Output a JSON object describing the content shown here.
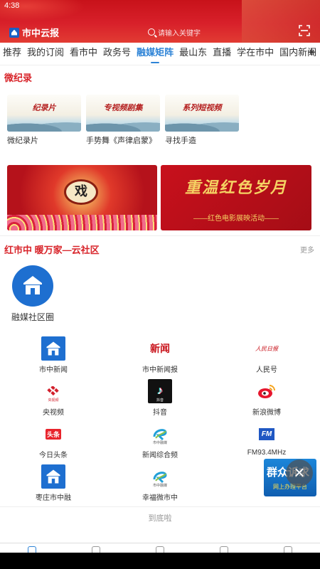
{
  "status": {
    "time": "4:38"
  },
  "header": {
    "brand": "市中云报",
    "search_placeholder": "请输入关键字"
  },
  "tabs": [
    "推荐",
    "我的订阅",
    "看市中",
    "政务号",
    "融媒矩阵",
    "最山东",
    "直播",
    "学在市中",
    "国内新闻"
  ],
  "active_tab": "融媒矩阵",
  "documentary": {
    "title": "微纪录",
    "items": [
      {
        "label": "微纪录片",
        "art": "纪录片"
      },
      {
        "label": "手势舞《声律启蒙》",
        "art": "专视频剧集"
      },
      {
        "label": "寻找手造",
        "art": "系列短视频"
      }
    ]
  },
  "banners": {
    "left_art": "戏",
    "right_art": "重温红色岁月",
    "right_sub": "——红色电影展映活动——"
  },
  "community": {
    "title": "红市中  暖万家—云社区",
    "more": "更多",
    "label": "融媒社区圈"
  },
  "grid": [
    {
      "label": "市中新闻",
      "icon": "shizhong-icon"
    },
    {
      "label": "市中新闻报",
      "icon": "xinwen-icon",
      "art": "新闻"
    },
    {
      "label": "人民号",
      "icon": "renmin-icon",
      "art": "人民日报"
    },
    {
      "label": "央视频",
      "icon": "cctv-icon",
      "art": "央视频"
    },
    {
      "label": "抖音",
      "icon": "douyin-icon",
      "art": "抖音"
    },
    {
      "label": "新浪微博",
      "icon": "weibo-icon"
    },
    {
      "label": "今日头条",
      "icon": "toutiao-icon",
      "art": "头条"
    },
    {
      "label": "新闻综合频",
      "icon": "news-channel-icon",
      "art": "市中融媒"
    },
    {
      "label": "FM93.4MHz",
      "icon": "fm-icon",
      "art": "FM"
    },
    {
      "label": "枣庄市中融",
      "icon": "zaozhuang-icon"
    },
    {
      "label": "幸福微市中",
      "icon": "xingfu-icon",
      "art": "市中融媒"
    }
  ],
  "float_ad": {
    "line1": "群众诉求",
    "line2": "网上办理平台"
  },
  "footer": {
    "end_text": "到底啦"
  },
  "colors": {
    "brand_red": "#d8202a",
    "accent_blue": "#2d83d6",
    "section_red": "#d8242a"
  }
}
